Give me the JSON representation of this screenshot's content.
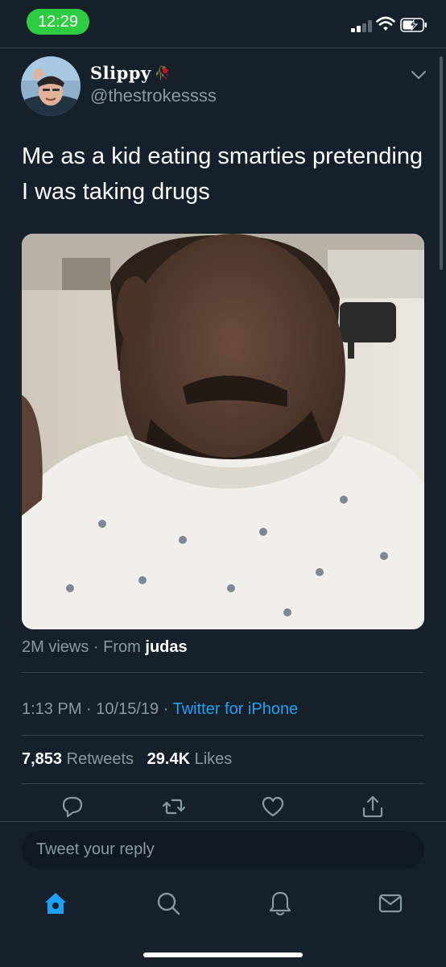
{
  "status_bar": {
    "time": "12:29"
  },
  "tweet": {
    "display_name": "Slippy",
    "handle": "@thestrokessss",
    "text": "Me as a kid eating smarties pretending I was taking drugs",
    "views": "2M views",
    "views_separator": "·",
    "from_label": "From",
    "source": "judas",
    "time": "1:13 PM",
    "date": "10/15/19",
    "separator": "·",
    "client": "Twitter for iPhone",
    "retweets_count": "7,853",
    "retweets_label": "Retweets",
    "likes_count": "29.4K",
    "likes_label": "Likes"
  },
  "reply": {
    "placeholder": "Tweet your reply"
  },
  "icons": {
    "back": "chevron-down-icon",
    "reply": "comment-icon",
    "retweet": "retweet-icon",
    "like": "heart-icon",
    "share": "share-icon",
    "home": "home-icon",
    "search": "search-icon",
    "notifications": "bell-icon",
    "messages": "mail-icon"
  },
  "colors": {
    "background": "#15202b",
    "accent": "#1da1f2",
    "muted": "#8899a6",
    "status_pill": "#2ecc40"
  }
}
